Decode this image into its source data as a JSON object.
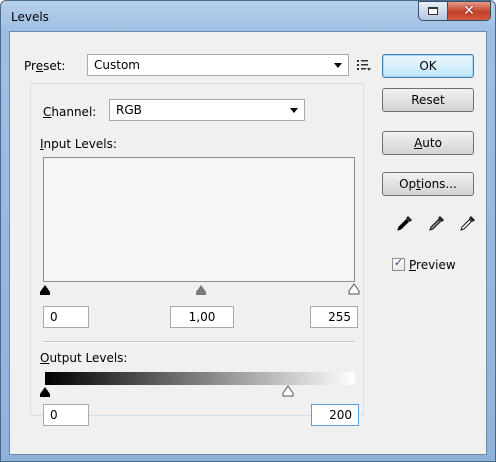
{
  "window": {
    "title": "Levels"
  },
  "preset": {
    "label_prefix": "Pr",
    "label_access": "e",
    "label_suffix": "set:",
    "value": "Custom"
  },
  "channel": {
    "label_access": "C",
    "label_suffix": "hannel:",
    "value": "RGB"
  },
  "input_levels": {
    "label_access": "I",
    "label_suffix": "nput Levels:",
    "black": "0",
    "gamma": "1,00",
    "white": "255"
  },
  "output_levels": {
    "label_access": "O",
    "label_suffix": "utput Levels:",
    "black": "0",
    "white": "200",
    "white_fraction": 0.784
  },
  "buttons": {
    "ok": "OK",
    "reset": "Reset",
    "auto_access": "A",
    "auto_suffix": "uto",
    "options_prefix": "Op",
    "options_access": "t",
    "options_suffix": "ions..."
  },
  "preview": {
    "checked": true,
    "label_access": "P",
    "label_suffix": "review"
  },
  "colors": {
    "accent": "#3c7fb1",
    "title_bar": "#9fbfe2",
    "close_button": "#c4412a"
  },
  "icons": [
    "preset-menu-icon",
    "black-eyedropper-icon",
    "gray-eyedropper-icon",
    "white-eyedropper-icon"
  ]
}
